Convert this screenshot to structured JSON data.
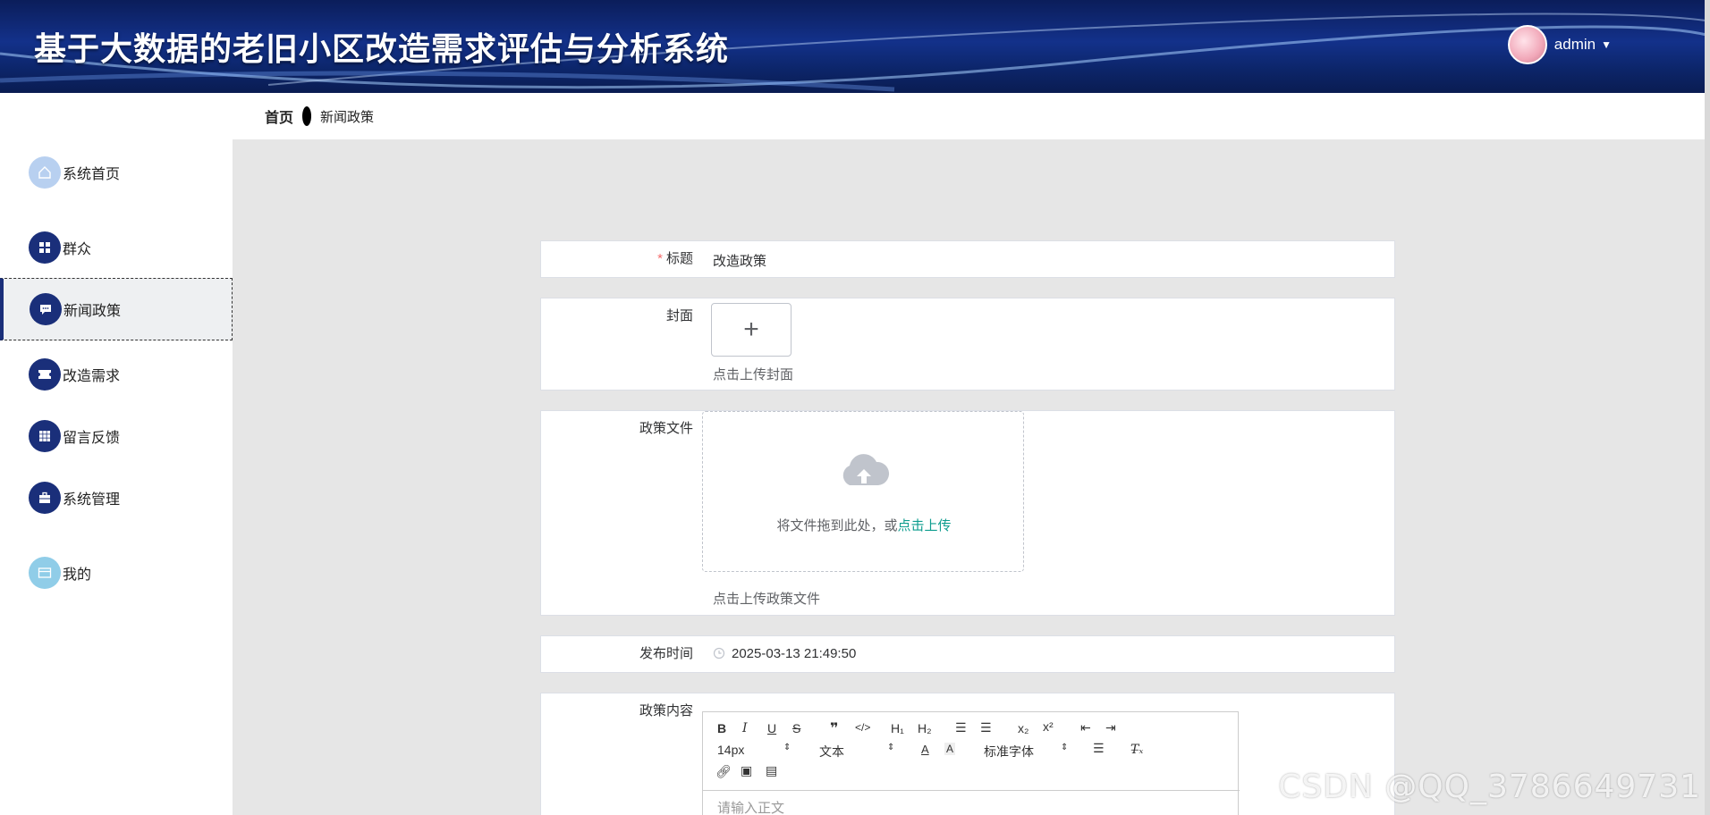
{
  "header": {
    "title": "基于大数据的老旧小区改造需求评估与分析系统",
    "username": "admin"
  },
  "breadcrumb": {
    "home": "首页",
    "current": "新闻政策"
  },
  "sidebar": {
    "items": [
      {
        "label": "系统首页",
        "icon": "home-icon"
      },
      {
        "label": "群众",
        "icon": "grid-icon"
      },
      {
        "label": "新闻政策",
        "icon": "message-icon",
        "active": true
      },
      {
        "label": "改造需求",
        "icon": "ticket-icon"
      },
      {
        "label": "留言反馈",
        "icon": "apps-icon"
      },
      {
        "label": "系统管理",
        "icon": "briefcase-icon"
      },
      {
        "label": "我的",
        "icon": "card-icon"
      }
    ]
  },
  "form": {
    "title_label": "标题",
    "title_value": "改造政策",
    "cover_label": "封面",
    "cover_tip": "点击上传封面",
    "file_label": "政策文件",
    "drag_text": "将文件拖到此处，或",
    "drag_link": "点击上传",
    "file_tip": "点击上传政策文件",
    "time_label": "发布时间",
    "time_value": "2025-03-13 21:49:50",
    "content_label": "政策内容",
    "editor": {
      "size": "14px",
      "block": "文本",
      "font": "标准字体",
      "placeholder": "请输入正文"
    }
  },
  "watermark": "CSDN @QQ_3786649731",
  "colors": {
    "accent": "#1a2f7a",
    "link": "#0f9d8f",
    "required": "#f56c6c"
  }
}
